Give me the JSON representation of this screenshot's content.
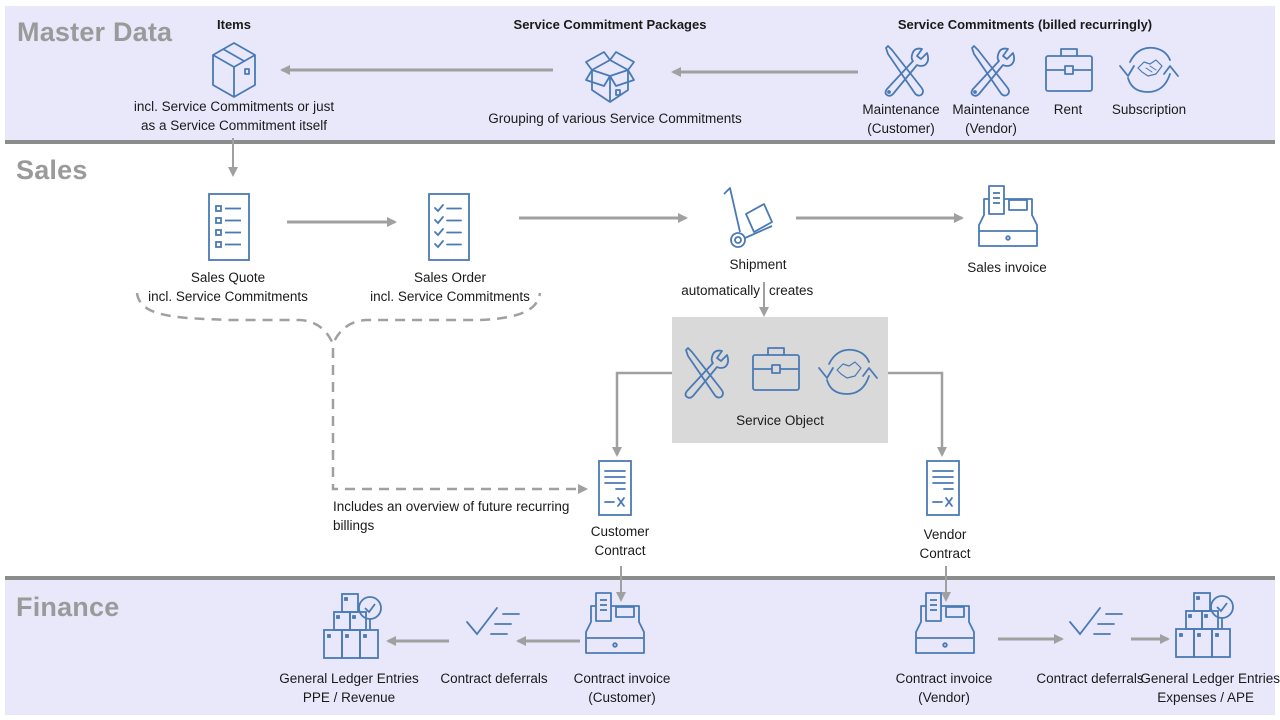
{
  "sections": {
    "master_data": "Master Data",
    "sales": "Sales",
    "finance": "Finance"
  },
  "master_data": {
    "items": {
      "header": "Items",
      "icon": "closed-box-icon",
      "caption_line1": "incl. Service Commitments or just",
      "caption_line2": "as a Service Commitment itself"
    },
    "packages": {
      "header": "Service Commitment Packages",
      "icon": "open-box-icon",
      "caption": "Grouping of various Service Commitments"
    },
    "commitments": {
      "header": "Service Commitments (billed recurringly)",
      "items": [
        {
          "icon": "tools-icon",
          "line1": "Maintenance",
          "line2": "(Customer)"
        },
        {
          "icon": "tools-icon",
          "line1": "Maintenance",
          "line2": "(Vendor)"
        },
        {
          "icon": "briefcase-icon",
          "line1": "Rent",
          "line2": ""
        },
        {
          "icon": "handshake-cycle-icon",
          "line1": "Subscription",
          "line2": ""
        }
      ]
    }
  },
  "sales": {
    "quote": {
      "icon": "checklist-icon",
      "line1": "Sales Quote",
      "line2": "incl. Service Commitments"
    },
    "order": {
      "icon": "checked-list-icon",
      "line1": "Sales Order",
      "line2": "incl. Service Commitments"
    },
    "shipment": {
      "icon": "hand-truck-icon",
      "label": "Shipment",
      "note_left": "automatically",
      "note_right": "creates"
    },
    "invoice": {
      "icon": "cash-register-icon",
      "label": "Sales invoice"
    },
    "service_object": {
      "label": "Service Object",
      "icons": [
        "tools-icon",
        "briefcase-icon",
        "handshake-cycle-icon"
      ]
    },
    "overview_note_line1": "Includes an overview of future recurring",
    "overview_note_line2": "billings",
    "customer_contract": {
      "icon": "contract-icon",
      "line1": "Customer",
      "line2": "Contract"
    },
    "vendor_contract": {
      "icon": "contract-icon",
      "line1": "Vendor",
      "line2": "Contract"
    }
  },
  "finance": {
    "customer": {
      "gl": {
        "line1": "General Ledger Entries",
        "line2": "PPE / Revenue"
      },
      "deferrals": {
        "label": "Contract deferrals"
      },
      "invoice": {
        "line1": "Contract invoice",
        "line2": "(Customer)"
      }
    },
    "vendor": {
      "invoice": {
        "line1": "Contract invoice",
        "line2": "(Vendor)"
      },
      "deferrals": {
        "label": "Contract deferrals"
      },
      "gl": {
        "line1": "General Ledger Entries",
        "line2": "Expenses / APE"
      }
    }
  },
  "colors": {
    "icon_blue": "#4a7ab5",
    "arrow_gray": "#a0a0a0",
    "band_lavender": "#e9e8fb",
    "section_title_gray": "#9a9a9a",
    "service_object_bg": "#d9d9d9"
  }
}
